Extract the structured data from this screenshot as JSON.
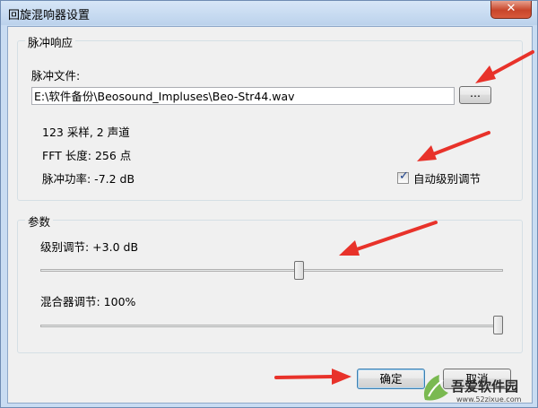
{
  "window": {
    "title": "回旋混响器设置",
    "close_label": "✕"
  },
  "impulse": {
    "group_title": "脉冲响应",
    "file_label": "脉冲文件:",
    "file_path": "E:\\软件备份\\Beosound_Impluses\\Beo-Str44.wav",
    "browse_label": "...",
    "info_samples": "123 采样, 2 声道",
    "info_fft": "FFT 长度: 256 点",
    "info_power": "脉冲功率: -7.2 dB",
    "auto_level_label": "自动级别调节",
    "auto_level_checked": true
  },
  "params": {
    "group_title": "参数",
    "level_label": "级别调节: +3.0 dB",
    "level_fraction": 0.56,
    "mixer_label": "混合器调节: 100%",
    "mixer_fraction": 1.0
  },
  "buttons": {
    "ok_label": "确定",
    "cancel_label": "取消"
  },
  "watermark": {
    "text": "吾爱软件园",
    "url": "www.52zixue.com"
  },
  "colors": {
    "arrow": "#e8322a"
  }
}
